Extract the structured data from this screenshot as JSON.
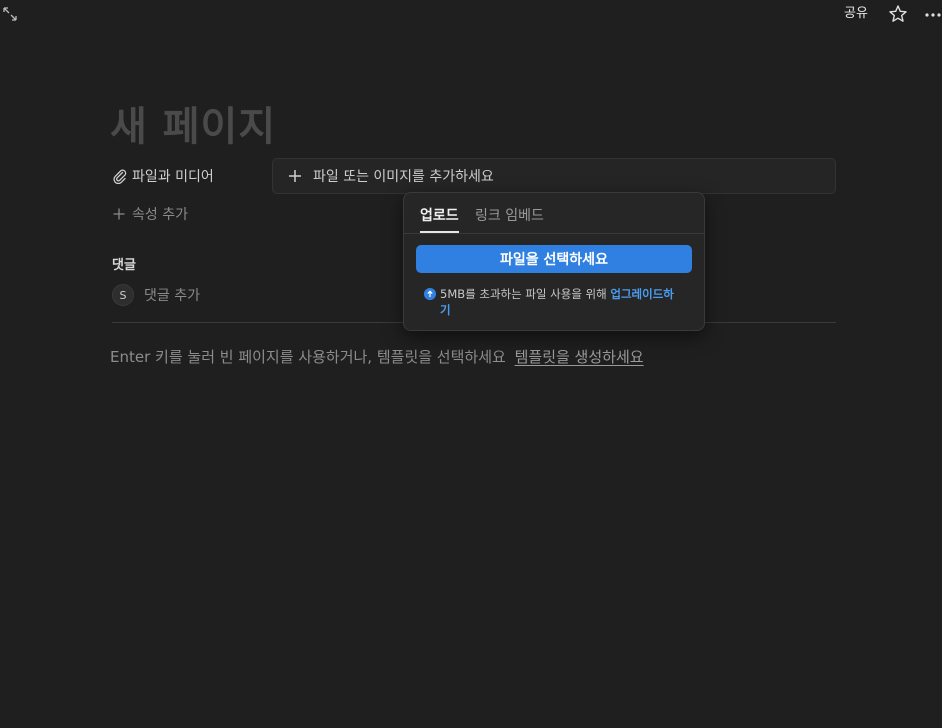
{
  "topbar": {
    "share_label": "공유",
    "icons": [
      "expand-icon",
      "star-icon",
      "more-icon"
    ]
  },
  "page": {
    "title": "새 페이지",
    "property": {
      "label": "파일과 미디어",
      "icon": "paperclip-icon",
      "field_placeholder": "파일 또는 이미지를 추가하세요"
    },
    "add_property_label": "속성 추가",
    "comments": {
      "heading": "댓글",
      "avatar_letter": "S",
      "add_comment_label": "댓글 추가"
    },
    "hint_text": "Enter 키를 눌러 빈 페이지를 사용하거나, 템플릿을 선택하세요",
    "hint_link": "템플릿을 생성하세요"
  },
  "popover": {
    "tabs": [
      {
        "label": "업로드",
        "active": true
      },
      {
        "label": "링크 임베드",
        "active": false
      }
    ],
    "choose_button_label": "파일을 선택하세요",
    "note_text": "5MB를 초과하는 파일 사용을 위해 ",
    "note_link": "업그레이드하기",
    "accent_color": "#2f80e0"
  }
}
